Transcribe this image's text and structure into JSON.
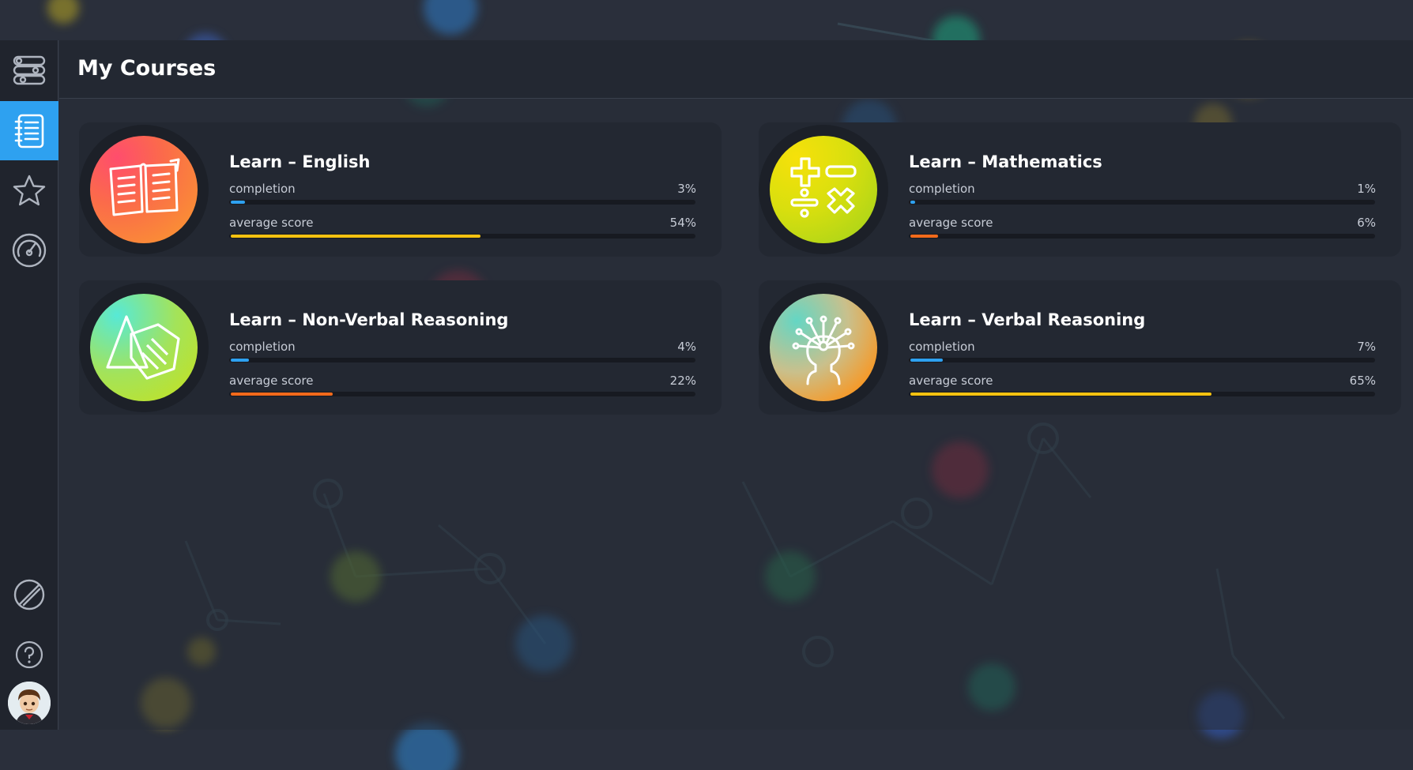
{
  "page": {
    "title": "My Courses"
  },
  "sidebar": {
    "items": [
      {
        "icon": "sliders-icon",
        "active": false
      },
      {
        "icon": "notebook-list-icon",
        "active": true
      },
      {
        "icon": "star-icon",
        "active": false
      },
      {
        "icon": "speedometer-icon",
        "active": false
      },
      {
        "icon": "slash-circle-icon",
        "active": false
      },
      {
        "icon": "help-icon",
        "active": false
      }
    ],
    "avatar": "user-avatar"
  },
  "courses": [
    {
      "title": "Learn – English",
      "icon": "open-book-icon",
      "completion": {
        "label": "completion",
        "value": "3%",
        "fraction": 0.03
      },
      "average_score": {
        "label": "average score",
        "value": "54%",
        "fraction": 0.54
      }
    },
    {
      "title": "Learn – Mathematics",
      "icon": "math-operators-icon",
      "completion": {
        "label": "completion",
        "value": "1%",
        "fraction": 0.01
      },
      "average_score": {
        "label": "average score",
        "value": "6%",
        "fraction": 0.06
      }
    },
    {
      "title": "Learn – Non-Verbal Reasoning",
      "icon": "shapes-icon",
      "completion": {
        "label": "completion",
        "value": "4%",
        "fraction": 0.04
      },
      "average_score": {
        "label": "average score",
        "value": "22%",
        "fraction": 0.22
      }
    },
    {
      "title": "Learn – Verbal Reasoning",
      "icon": "head-ideas-icon",
      "completion": {
        "label": "completion",
        "value": "7%",
        "fraction": 0.07
      },
      "average_score": {
        "label": "average score",
        "value": "65%",
        "fraction": 0.65
      }
    }
  ],
  "colors": {
    "accent": "#2ea1f0",
    "completion_bar": "#2ea1f0",
    "score_low": "#f26a1b",
    "score_mid": "#f5c211"
  }
}
